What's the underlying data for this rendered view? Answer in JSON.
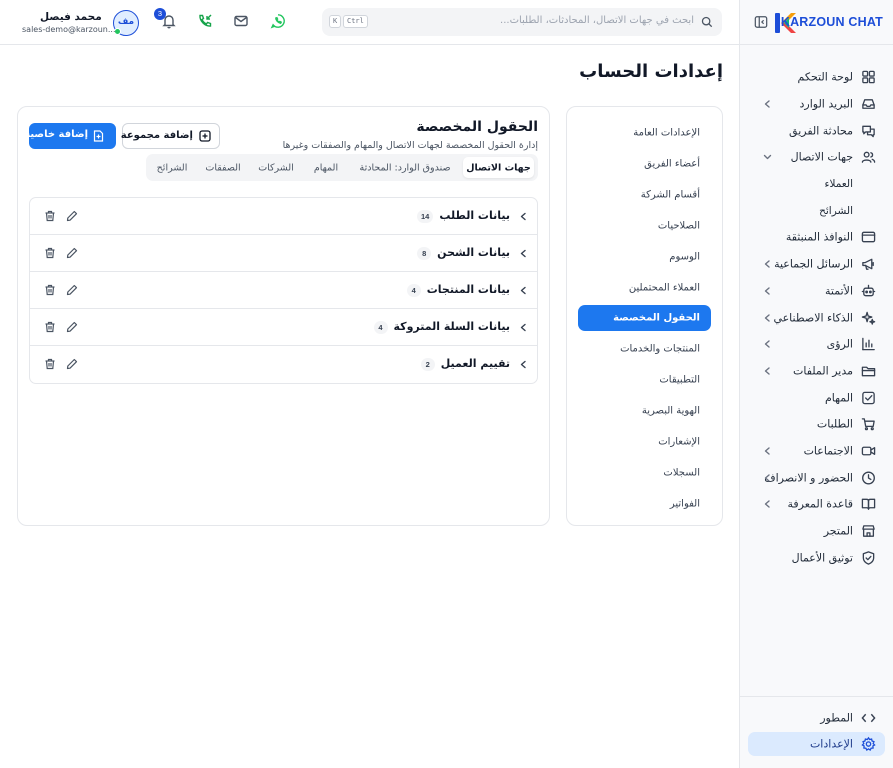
{
  "sidebar": {
    "brand": "KARZOUN CHAT",
    "items": [
      {
        "label": "لوحة التحكم",
        "icon": "dashboard-icon",
        "chevron": false
      },
      {
        "label": "البريد الوارد",
        "icon": "inbox-icon",
        "chevron": true
      },
      {
        "label": "محادثة الفريق",
        "icon": "team-chat-icon",
        "chevron": false
      },
      {
        "label": "جهات الاتصال",
        "icon": "contacts-icon",
        "chevron": true,
        "expanded": true
      },
      {
        "label": "العملاء",
        "sub": true
      },
      {
        "label": "الشرائح",
        "sub": true
      },
      {
        "label": "النوافذ المنبثقة",
        "icon": "popup-icon",
        "chevron": false
      },
      {
        "label": "الرسائل الجماعية",
        "icon": "megaphone-icon",
        "chevron": true
      },
      {
        "label": "الأتمتة",
        "icon": "bot-icon",
        "chevron": true
      },
      {
        "label": "الذكاء الاصطناعي",
        "icon": "sparkles-icon",
        "chevron": true
      },
      {
        "label": "الرؤى",
        "icon": "chart-icon",
        "chevron": true
      },
      {
        "label": "مدير الملفات",
        "icon": "folder-icon",
        "chevron": true
      },
      {
        "label": "المهام",
        "icon": "task-check-icon",
        "chevron": false
      },
      {
        "label": "الطلبات",
        "icon": "cart-icon",
        "chevron": false
      },
      {
        "label": "الاجتماعات",
        "icon": "video-icon",
        "chevron": true
      },
      {
        "label": "الحضور و الانصراف",
        "icon": "clock-icon",
        "chevron": true
      },
      {
        "label": "قاعدة المعرفة",
        "icon": "book-icon",
        "chevron": true
      },
      {
        "label": "المتجر",
        "icon": "store-icon",
        "chevron": false
      },
      {
        "label": "توثيق الأعمال",
        "icon": "shield-check-icon",
        "chevron": false
      }
    ],
    "developer": "المطور",
    "settings": "الإعدادات"
  },
  "topbar": {
    "search_placeholder": "ابحث في جهات الاتصال، المحادثات، الطلبات...",
    "kbd_ctrl": "Ctrl",
    "kbd_k": "K",
    "notifications_count": "3",
    "avatar_initials": "مف",
    "user_name": "محمد فيصل",
    "user_email": "sales-demo@karzoun..."
  },
  "page": {
    "title": "إعدادات الحساب"
  },
  "settings_nav": {
    "items": [
      "الإعدادات العامة",
      "أعضاء الفريق",
      "أقسام الشركة",
      "الصلاحيات",
      "الوسوم",
      "العملاء المحتملين",
      "الحقول المخصصة",
      "المنتجات والخدمات",
      "التطبيقات",
      "الهوية البصرية",
      "الإشعارات",
      "السجلات",
      "الفواتير"
    ],
    "active_index": 6
  },
  "custom_fields": {
    "title": "الحقول المخصصة",
    "subtitle": "إدارة الحقول المخصصة لجهات الاتصال والمهام والصفقات وغيرها",
    "add_field_label": "إضافة خاصية",
    "add_group_label": "إضافة مجموعة",
    "tabs": [
      "جهات الاتصال",
      "صندوق الوارد: المحادثة",
      "المهام",
      "الشركات",
      "الصفقات",
      "الشرائح"
    ],
    "active_tab": 0,
    "groups": [
      {
        "name": "بيانات الطلب",
        "count": "14"
      },
      {
        "name": "بيانات الشحن",
        "count": "8"
      },
      {
        "name": "بيانات المنتجات",
        "count": "4"
      },
      {
        "name": "بيانات السلة المتروكة",
        "count": "4"
      },
      {
        "name": "تقييم العميل",
        "count": "2"
      }
    ]
  },
  "colors": {
    "primary": "#1d78ef",
    "brand": "#1d4ed8",
    "whatsapp": "#22c55e",
    "active_nav_bg": "#dbeafe"
  }
}
